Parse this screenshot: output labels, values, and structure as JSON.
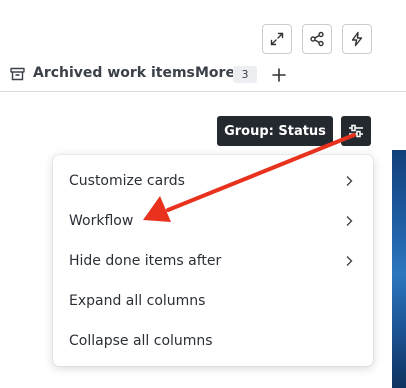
{
  "toolbar": {
    "icons": [
      "expand-icon",
      "share-icon",
      "lightning-icon"
    ]
  },
  "tabs": {
    "archived_label": "Archived work items",
    "more_label": "More",
    "more_count": "3"
  },
  "board": {
    "group_label": "Group: Status"
  },
  "menu": {
    "items": [
      {
        "label": "Customize cards",
        "has_submenu": true
      },
      {
        "label": "Workflow",
        "has_submenu": true
      },
      {
        "label": "Hide done items after",
        "has_submenu": true
      },
      {
        "label": "Expand all columns",
        "has_submenu": false
      },
      {
        "label": "Collapse all columns",
        "has_submenu": false
      }
    ]
  },
  "colors": {
    "annotation_arrow": "#e8321e",
    "dark_button": "#24292f"
  }
}
